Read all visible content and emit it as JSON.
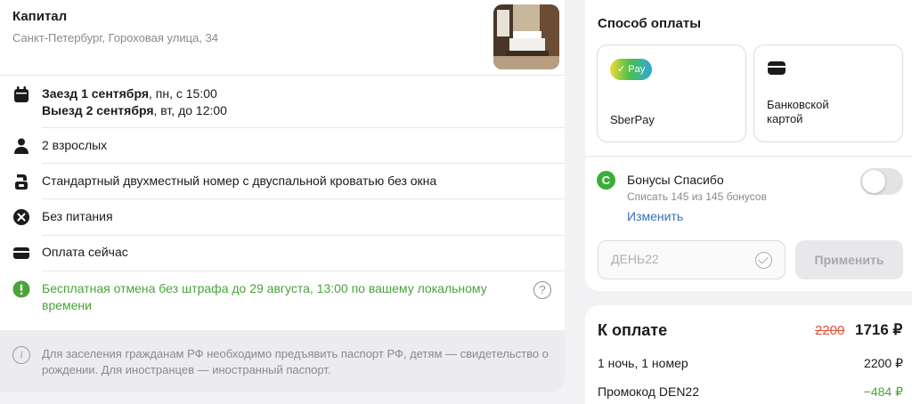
{
  "hotel": {
    "name": "Капитал",
    "address": "Санкт-Петербург, Гороховая улица, 34"
  },
  "booking": {
    "checkin_bold": "Заезд 1 сентября",
    "checkin_rest": ", пн, с 15:00",
    "checkout_bold": "Выезд 2 сентября",
    "checkout_rest": ", вт, до 12:00",
    "guests": "2 взрослых",
    "room": "Стандартный двухместный номер с двуспальной кроватью без окна",
    "meal": "Без питания",
    "payment": "Оплата сейчас",
    "cancellation": "Бесплатная отмена без штрафа до 29 августа, 13:00 по вашему локальному времени",
    "passport_note": "Для заселения гражданам РФ необходимо предъявить паспорт РФ, детям — свидетельство о рождении. Для иностранцев — иностранный паспорт."
  },
  "payment_method": {
    "title": "Способ оплаты",
    "sberpay_badge": "Pay",
    "sberpay_label": "SberPay",
    "card_label": "Банковской картой"
  },
  "bonus": {
    "title": "Бонусы Спасибо",
    "subtitle": "Списать 145 из 145 бонусов",
    "change_link": "Изменить",
    "enabled": false
  },
  "promo": {
    "value": "ДЕНЬ22",
    "apply_label": "Применить"
  },
  "summary": {
    "title": "К оплате",
    "old_price": "2200",
    "new_price": "1716 ₽",
    "lines": [
      {
        "label": "1 ночь, 1 номер",
        "value": "2200 ₽"
      },
      {
        "label": "Промокод DEN22",
        "value": "−484 ₽"
      }
    ]
  },
  "colors": {
    "green": "#4aa33a",
    "link": "#3a6fb8",
    "old_price": "#e0533d"
  }
}
